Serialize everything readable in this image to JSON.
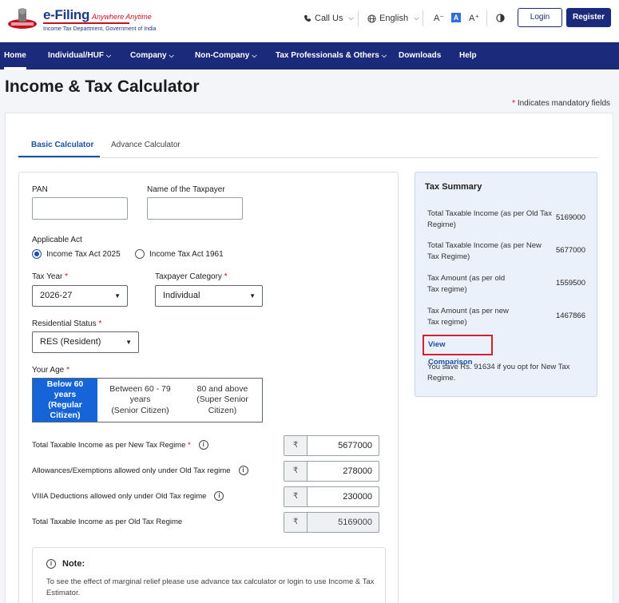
{
  "header": {
    "logo_brand": "e-Filing",
    "logo_tagline": "Anywhere Anytime",
    "logo_subtitle": "Income Tax Department, Government of India",
    "call_us": "Call Us",
    "language": "English",
    "font_decrease": "A⁻",
    "font_normal": "A",
    "font_increase": "A⁺",
    "login": "Login",
    "register": "Register"
  },
  "nav": {
    "items": [
      "Home",
      "Individual/HUF",
      "Company",
      "Non-Company",
      "Tax Professionals & Others",
      "Downloads",
      "Help"
    ]
  },
  "page": {
    "title": "Income & Tax Calculator",
    "mandatory_star": "*",
    "mandatory_note": "Indicates mandatory fields"
  },
  "tabs": [
    "Basic Calculator",
    "Advance Calculator"
  ],
  "form": {
    "pan_label": "PAN",
    "pan_value": "",
    "name_label": "Name of the Taxpayer",
    "name_value": "",
    "act_label": "Applicable Act",
    "act_options": [
      "Income Tax Act 2025",
      "Income Tax Act 1961"
    ],
    "act_selected": "Income Tax Act 2025",
    "tax_year_label": "Tax Year",
    "tax_year_value": "2026-27",
    "category_label": "Taxpayer Category",
    "category_value": "Individual",
    "residential_label": "Residential Status",
    "residential_value": "RES (Resident)",
    "age_label": "Your Age",
    "age_options": [
      {
        "l1": "Below 60",
        "l2": "years",
        "l3": "(Regular",
        "l4": "Citizen)"
      },
      {
        "l1": "Between 60 - 79",
        "l2": "years",
        "l3": "(Senior Citizen)"
      },
      {
        "l1": "80 and above",
        "l2": "(Super Senior",
        "l3": "Citizen)"
      }
    ],
    "required_mark": "*",
    "currency_symbol": "₹",
    "rows": [
      {
        "label": "Total Taxable Income as per New Tax Regime",
        "required": true,
        "value": "5677000"
      },
      {
        "label": "Allowances/Exemptions allowed only under Old Tax regime",
        "value": "278000"
      },
      {
        "label": "VIIIA Deductions allowed only under Old Tax regime",
        "value": "230000"
      },
      {
        "label": "Total Taxable Income as per Old Tax Regime",
        "value": "5169000"
      }
    ],
    "note_title": "Note:",
    "note_text": "To see the effect of marginal relief please use advance tax calculator or login to use Income & Tax Estimator."
  },
  "summary": {
    "title": "Tax Summary",
    "items": [
      {
        "label": "Total Taxable Income (as per Old Tax Regime)",
        "value": "5169000"
      },
      {
        "label": "Total Taxable Income (as per New Tax Regime)",
        "value": "5677000"
      },
      {
        "label": "Tax Amount (as per old Tax regime)",
        "value": "1559500"
      },
      {
        "label": "Tax Amount (as per new Tax regime)",
        "value": "1467866"
      }
    ],
    "view_comparison": "View Comparison",
    "savings_text": "You save Rs. 91634 if you opt for New Tax Regime."
  },
  "colors": {
    "nav_bg": "#1b2a7a",
    "accent_blue": "#1565d8",
    "required_red": "#c4111f",
    "highlight_red": "#d6202f",
    "summary_bg": "#eaf1fb"
  }
}
